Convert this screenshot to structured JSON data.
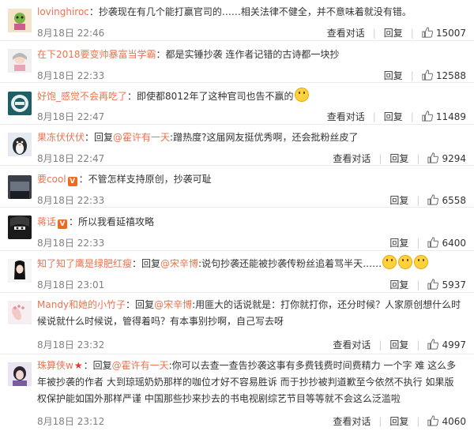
{
  "labels": {
    "view_dialog": "查看对话",
    "reply": "回复"
  },
  "comments": [
    {
      "username": "lovinghiroc",
      "text": "：抄袭现在有几个能打赢官司的……相关法律不健全，并不意味着就没有错。",
      "time": "8月18日 22:46",
      "has_view_dialog": true,
      "likes": "15007"
    },
    {
      "username": "在下2018要变帅暴富当学霸",
      "text": "：都是实锤抄袭 连作者记错的古诗都一块抄",
      "time": "8月18日 22:33",
      "has_view_dialog": false,
      "likes": "12588"
    },
    {
      "username": "好饱_感觉不会再吃了",
      "text": "：即使都8012年了这种官司也告不赢的",
      "time": "8月18日 22:47",
      "has_view_dialog": true,
      "likes": "11489"
    },
    {
      "username": "果冻伏伏伏",
      "reply_prefix": "：回复",
      "mention": "@霍许有一天",
      "text": ":蹭热度?这届网友挺优秀啊，还会批粉丝皮了",
      "time": "8月18日 22:47",
      "has_view_dialog": true,
      "likes": "9294"
    },
    {
      "username": "要cool",
      "text": "：不管怎样支持原创，抄袭可耻",
      "time": "8月18日 22:33",
      "has_view_dialog": false,
      "likes": "6558"
    },
    {
      "username": "蒋话",
      "text": "：所以我看延禧攻略",
      "time": "8月18日 22:33",
      "has_view_dialog": false,
      "likes": "6400"
    },
    {
      "username": "知了知了鹰是绿肥红瘦",
      "reply_prefix": "：回复",
      "mention": "@宋辛博",
      "text": ":说句抄袭还能被抄袭传粉丝追着骂半天……",
      "time": "8月18日 23:01",
      "has_view_dialog": false,
      "likes": "5937"
    },
    {
      "username": "Mandy和她的小竹子",
      "reply_prefix": "：回复",
      "mention": "@宋辛博",
      "text": ":用匪大的话说就是：打你就打你，还分时候？人家原创想什么时候说就什么时候说，管得着吗？有本事别抄啊，自己写去呀",
      "time": "8月18日 23:32",
      "has_view_dialog": true,
      "likes": "4997"
    },
    {
      "username": "珠算侠w",
      "reply_prefix": "：回复",
      "mention": "@霍许有一天",
      "text": ":你可以去查一查告抄袭这事有多费钱费时间费精力 一个字 难 这么多年被抄袭的作者 大到琼瑶奶奶那样的咖位才好不容易胜诉 而于抄抄被判道歉至今依然不执行 如果版权保护能如国外那样严谨 中国那些抄来抄去的书电视剧综艺节目等等就不会这么泛滥啦",
      "time": "8月18日 23:12",
      "has_view_dialog": true,
      "likes": "4060"
    }
  ]
}
